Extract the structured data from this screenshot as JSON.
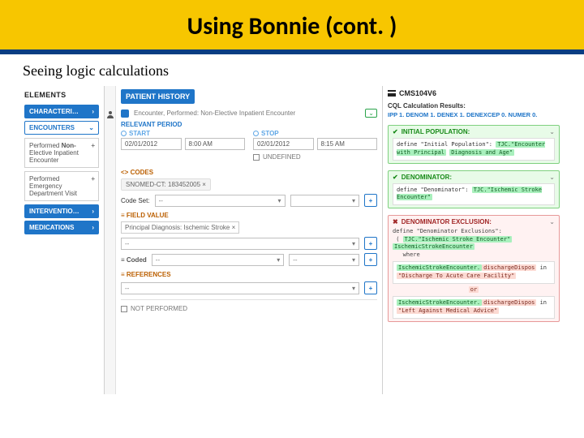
{
  "slide": {
    "title": "Using Bonnie (cont. )",
    "subtitle": "Seeing logic calculations"
  },
  "elements": {
    "header": "ELEMENTS",
    "characteristics": "CHARACTERI…",
    "encounters": "ENCOUNTERS",
    "card1_l1": "Performed",
    "card1_l2": "Elective Inpatient",
    "card1_l3": "Encounter",
    "card1_bold": "Non-",
    "card2_l1": "Performed",
    "card2_l2": "Emergency",
    "card2_l3": "Department Visit",
    "interventio": "INTERVENTIO…",
    "medications": "MEDICATIONS"
  },
  "patient": {
    "tab": "PATIENT HISTORY",
    "encounter_title": "Encounter, Performed: Non-Elective Inpatient Encounter",
    "relevant_period": "RELEVANT PERIOD",
    "start_label": "START",
    "stop_label": "STOP",
    "start_date": "02/01/2012",
    "start_time": "8:00 AM",
    "stop_date": "02/01/2012",
    "stop_time": "8:15 AM",
    "undefined": "UNDEFINED",
    "codes_label": "CODES",
    "code_value": "SNOMED-CT: 183452005",
    "codeset_label": "Code Set:",
    "dash": "--",
    "field_value": "FIELD VALUE",
    "principal_diag": "Principal Diagnosis: Ischemic Stroke",
    "coded": "Coded",
    "references": "REFERENCES",
    "not_performed": "NOT PERFORMED"
  },
  "results": {
    "measure": "CMS104V6",
    "calc_heading": "CQL Calculation Results:",
    "summary": "IPP 1. DENOM 1. DENEX 1. DENEXCEP 0. NUMER 0.",
    "ipp_title": "INITIAL POPULATION:",
    "ipp_l1": "define \"Initial Population\":",
    "ipp_l2": "TJC.\"Encounter with Principal",
    "ipp_l3": "Diagnosis and Age\"",
    "denom_title": "DENOMINATOR:",
    "denom_l1": "define \"Denominator\":",
    "denom_l2": "TJC.\"Ischemic Stroke Encounter\"",
    "denex_title": "DENOMINATOR EXCLUSION:",
    "denex_l1": "define \"Denominator Exclusions\":",
    "denex_l2": "TJC.\"Ischemic Stroke Encounter\"",
    "denex_l3": "IschemicStrokeEncounter",
    "denex_l4": "where",
    "denex_box1a": "IschemicStrokeEncounter.",
    "denex_box1b": "dischargeDispos",
    "denex_box1c": "in",
    "denex_box1d": "\"Discharge To Acute Care Facility\"",
    "denex_or": "or",
    "denex_box2a": "IschemicStrokeEncounter.",
    "denex_box2b": "dischargeDispos",
    "denex_box2c": "in",
    "denex_box2d": "\"Left Against Medical Advice\""
  }
}
